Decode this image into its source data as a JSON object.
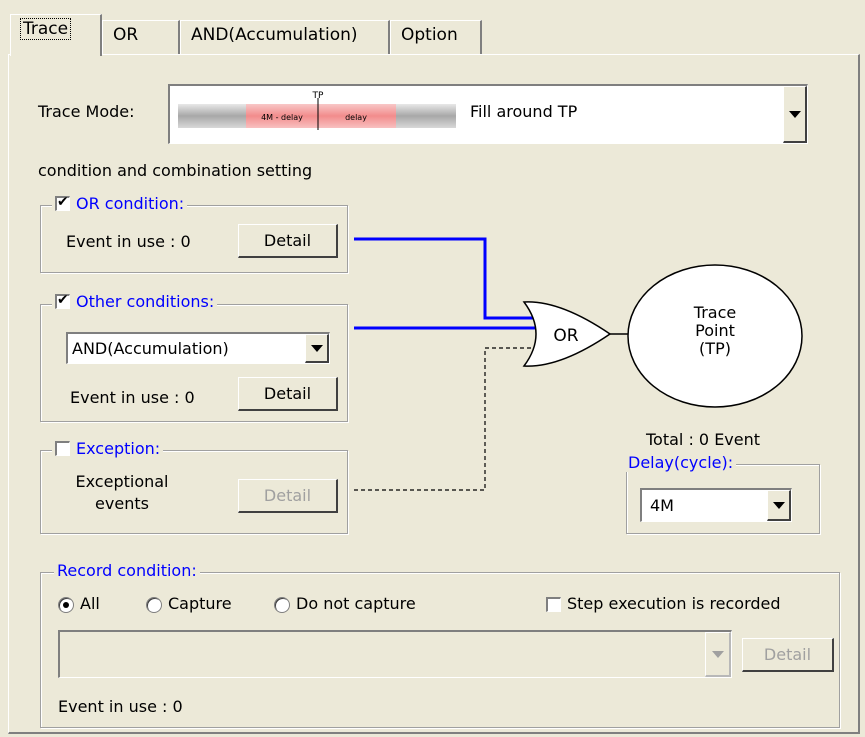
{
  "tabs": [
    "Trace",
    "OR",
    "AND(Accumulation)",
    "Option"
  ],
  "trace_mode": {
    "label": "Trace Mode:",
    "diagram": {
      "tp": "TP",
      "left": "4M - delay",
      "right": "delay"
    },
    "value": "Fill around TP"
  },
  "section_title": "condition and combination setting",
  "or_condition": {
    "label": "OR condition:",
    "checked": true,
    "event_text": "Event in use :  0",
    "detail": "Detail"
  },
  "other_conditions": {
    "label": "Other conditions:",
    "checked": true,
    "select_value": "AND(Accumulation)",
    "event_text": "Event in use : 0",
    "detail": "Detail"
  },
  "exception": {
    "label": "Exception:",
    "checked": false,
    "text_line1": "Exceptional",
    "text_line2": "events",
    "detail": "Detail"
  },
  "gate_label": "OR",
  "trace_point": {
    "line1": "Trace",
    "line2": "Point",
    "line3": "(TP)"
  },
  "total_text": "Total : 0  Event",
  "delay": {
    "label": "Delay(cycle):",
    "value": "4M"
  },
  "record": {
    "label": "Record condition:",
    "options": [
      "All",
      "Capture",
      "Do not capture"
    ],
    "selected": "All",
    "step_label": "Step execution is recorded",
    "detail": "Detail",
    "event_text": "Event in use : 0"
  },
  "colors": {
    "wire": "#0000ff",
    "accent_text": "#0000ff",
    "face": "#ECE9D8",
    "diagram_pink": "#F2A4A4"
  }
}
